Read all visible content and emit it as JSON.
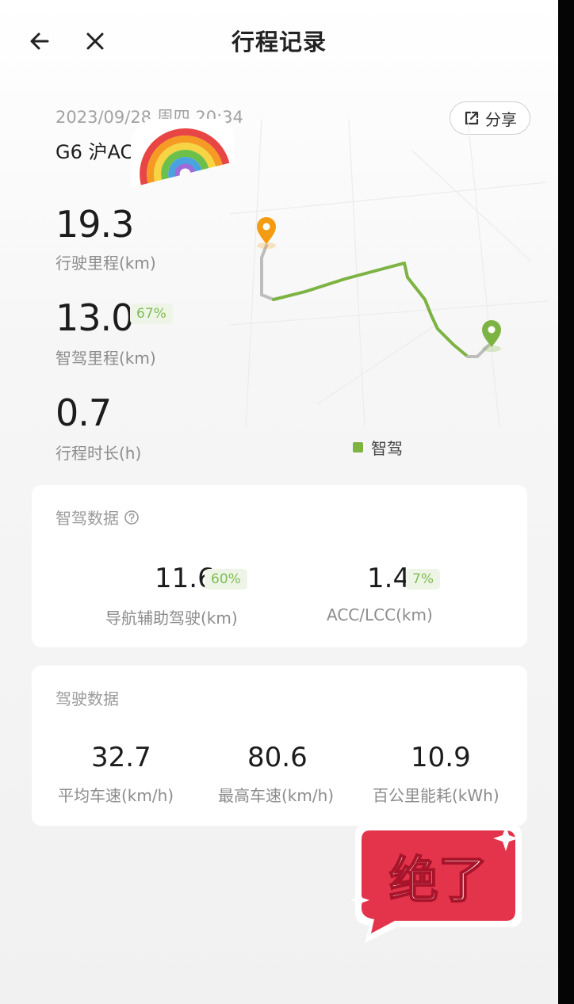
{
  "header": {
    "title": "行程记录",
    "back_icon": "arrow-left-icon",
    "close_icon": "close-icon"
  },
  "trip": {
    "datetime": "2023/09/28 周四 20:34",
    "route": "G6 沪AC",
    "share_label": "分享",
    "distance_value": "19.3",
    "distance_label": "行驶里程(km)",
    "smart_value": "13.0",
    "smart_percent": "67%",
    "smart_label": "智驾里程(km)",
    "duration_value": "0.7",
    "duration_label": "行程时长(h)"
  },
  "map": {
    "legend_label": "智驾",
    "smart_color": "#7cb342",
    "start_color": "#f39c12",
    "end_color": "#7cb342"
  },
  "smart_card": {
    "title": "智驾数据",
    "nav_value": "11.6",
    "nav_percent": "60%",
    "nav_label": "导航辅助驾驶(km)",
    "acc_value": "1.4",
    "acc_percent": "7%",
    "acc_label": "ACC/LCC(km)"
  },
  "drive_card": {
    "title": "驾驶数据",
    "avg_speed_value": "32.7",
    "avg_speed_label": "平均车速(km/h)",
    "max_speed_value": "80.6",
    "max_speed_label": "最高车速(km/h)",
    "energy_value": "10.9",
    "energy_label": "百公里能耗(kWh)"
  },
  "stickers": {
    "wow_text": "绝了"
  }
}
